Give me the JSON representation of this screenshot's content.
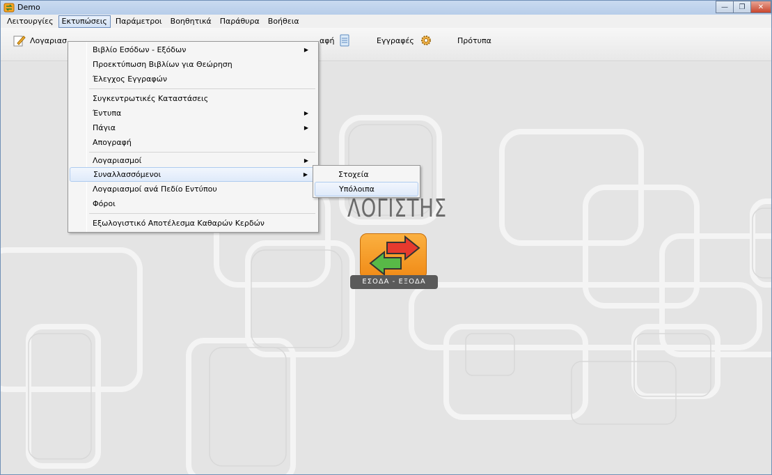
{
  "window": {
    "title": "Demo"
  },
  "menubar": {
    "items": [
      "Λειτουργίες",
      "Εκτυπώσεις",
      "Παράμετροι",
      "Βοηθητικά",
      "Παράθυρα",
      "Βοήθεια"
    ]
  },
  "toolbar": {
    "accounts_label": "Λογαριασ",
    "entry_label": "αφή",
    "entries_label": "Εγγραφές",
    "templates_label": "Πρότυπα"
  },
  "dropdown": {
    "items": [
      "Βιβλίο Εσόδων - Εξόδων",
      "Προεκτύπωση Βιβλίων για Θεώρηση",
      "Έλεγχος Εγγραφών",
      "Συγκεντρωτικές Καταστάσεις",
      "Έντυπα",
      "Πάγια",
      "Απογραφή",
      "Λογαριασμοί",
      "Συναλλασσόμενοι",
      "Λογαριασμοί ανά Πεδίο Εντύπου",
      "Φόροι",
      "Εξωλογιστικό Αποτέλεσμα Καθαρών Κερδών"
    ]
  },
  "submenu": {
    "items": [
      "Στοχεία",
      "Υπόλοιπα"
    ]
  },
  "logo": {
    "word": "ΛΟΓΙΣΤΗΣ",
    "strip": "ΕΣΟΔΑ - ΕΞΟΔΑ"
  },
  "colors": {
    "accent": "#f39a1f",
    "highlight_border": "#aecbef",
    "titlebar": "#c9daf0"
  }
}
